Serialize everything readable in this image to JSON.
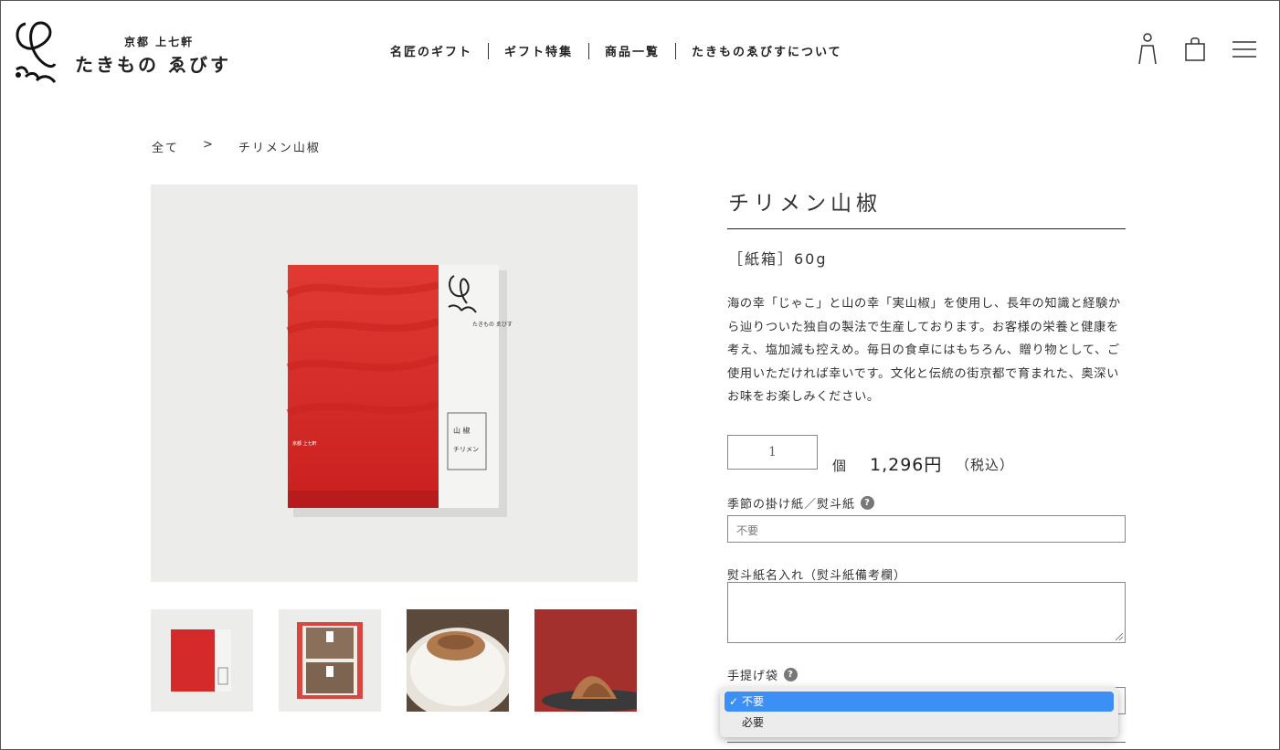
{
  "brand": {
    "sub": "京都 上七軒",
    "name": "たきもの ゑびす"
  },
  "nav": [
    {
      "label": "名匠のギフト"
    },
    {
      "label": "ギフト特集"
    },
    {
      "label": "商品一覧"
    },
    {
      "label": "たきものゑびすについて"
    }
  ],
  "breadcrumb": {
    "root": "全て",
    "separator": ">",
    "current": "チリメン山椒"
  },
  "product": {
    "title": "チリメン山椒",
    "spec": "［紙箱］60g",
    "description": "海の幸「じゃこ」と山の幸「実山椒」を使用し、長年の知識と経験から辿りついた独自の製法で生産しております。お客様の栄養と健康を考え、塩加減も控えめ。毎日の食卓にはもちろん、贈り物として、ご使用いただければ幸いです。文化と伝統の街京都で育まれた、奥深いお味をお楽しみください。",
    "quantity": "1",
    "quantity_unit": "個",
    "price": "1,296円",
    "tax_note": "（税込）",
    "package": {
      "brand_small": "たきもの ゑびす",
      "label_a": "山 椒",
      "label_b": "チリメン",
      "side_text": "京都 上七軒"
    }
  },
  "form": {
    "noshi_label": "季節の掛け紙／熨斗紙",
    "noshi_value": "不要",
    "noshi_name_label": "熨斗紙名入れ（熨斗紙備考欄）",
    "bag_label": "手提げ袋",
    "help_glyph": "?",
    "bag_options": [
      {
        "label": "不要",
        "selected": true
      },
      {
        "label": "必要",
        "selected": false
      }
    ],
    "check_glyph": "✓"
  },
  "colors": {
    "package_red": "#d42a2a",
    "selected_option": "#3b8ff5"
  },
  "icons": [
    "user-icon",
    "bag-icon",
    "menu-icon",
    "help-icon"
  ]
}
